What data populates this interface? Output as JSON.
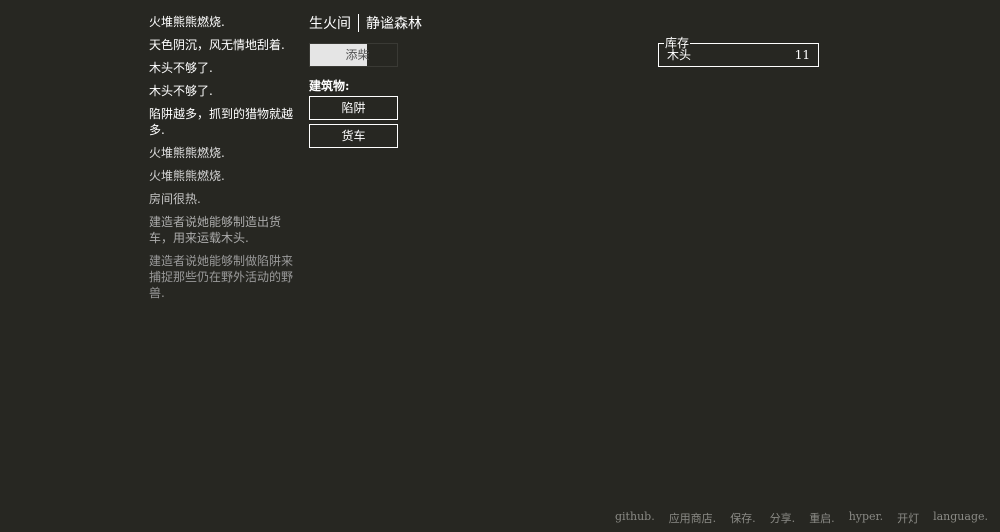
{
  "notifications": [
    "火堆熊熊燃烧.",
    "天色阴沉，风无情地刮着.",
    "木头不够了.",
    "木头不够了.",
    "陷阱越多，抓到的猎物就越多.",
    "火堆熊熊燃烧.",
    "火堆熊熊燃烧.",
    "房间很热.",
    "建造者说她能够制造出货车，用来运载木头.",
    "建造者说她能够制做陷阱来捕捉那些仍在野外活动的野兽."
  ],
  "notification_colors": [
    "#ffffff",
    "#ffffff",
    "#ffffff",
    "#ffffff",
    "#ffffff",
    "#e0e0e0",
    "#d4d4d4",
    "#c4c4c4",
    "#ababab",
    "#9a9a9a"
  ],
  "header": {
    "room": "生火间",
    "forest": "静谧森林"
  },
  "actions": {
    "stoke": "添柴",
    "stoke_cooldown_fraction": 0.66
  },
  "buildings": {
    "title": "建筑物:",
    "trap": "陷阱",
    "cart": "货车"
  },
  "stores": {
    "legend": "库存",
    "items": [
      {
        "name": "木头",
        "count": "11"
      }
    ]
  },
  "footer": {
    "github": "github.",
    "app_store": "应用商店.",
    "save": "保存.",
    "share": "分享.",
    "restart": "重启.",
    "hyper": "hyper.",
    "lights": "开灯",
    "language": "language."
  }
}
